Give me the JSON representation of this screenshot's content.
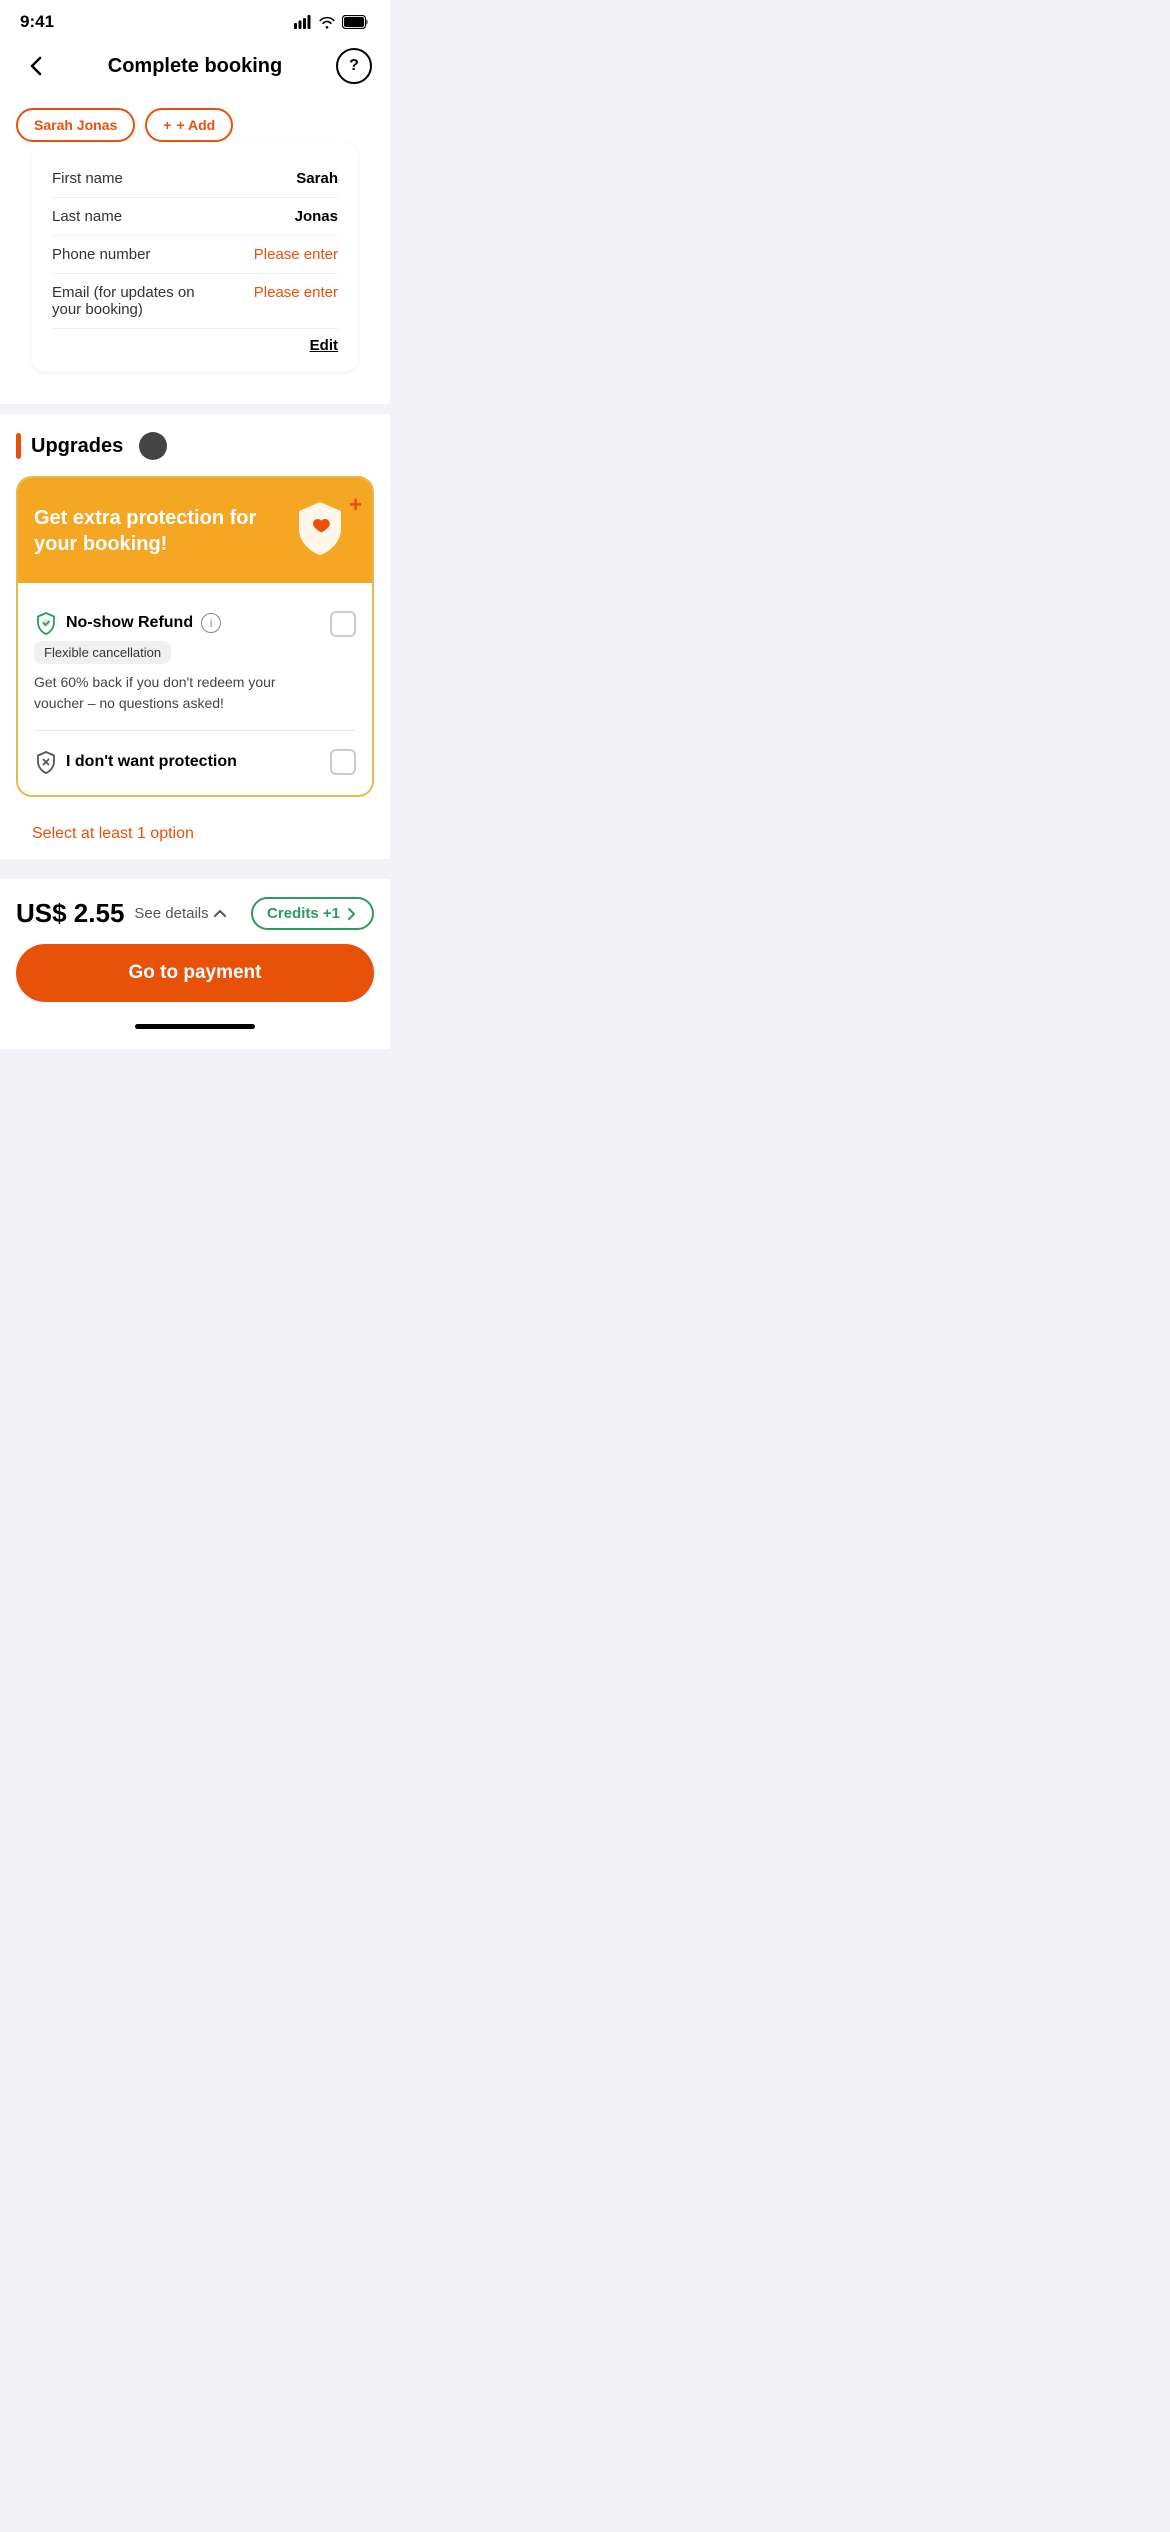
{
  "statusBar": {
    "time": "9:41",
    "signal": "●●●●",
    "wifi": "wifi",
    "battery": "battery"
  },
  "nav": {
    "title": "Complete booking",
    "backLabel": "‹",
    "helpLabel": "?"
  },
  "travelerChips": {
    "name": "Sarah Jonas",
    "addLabel": "+ Add"
  },
  "infoCard": {
    "rows": [
      {
        "label": "First name",
        "value": "Sarah",
        "isPlaceholder": false
      },
      {
        "label": "Last name",
        "value": "Jonas",
        "isPlaceholder": false
      },
      {
        "label": "Phone number",
        "value": "Please enter",
        "isPlaceholder": true
      },
      {
        "label": "Email (for updates on your booking)",
        "value": "Please enter",
        "isPlaceholder": true
      }
    ],
    "editLabel": "Edit"
  },
  "upgrades": {
    "sectionTitle": "Upgrades",
    "cardTitle": "Get extra protection for your booking!",
    "options": [
      {
        "icon": "shield-check-icon",
        "title": "No-show Refund",
        "badge": "Flexible cancellation",
        "description": "Get 60% back if you don't redeem your voucher – no questions asked!",
        "checked": false
      }
    ],
    "noProtection": {
      "title": "I don't want protection",
      "checked": false
    },
    "validationMsg": "Select at least 1 option"
  },
  "footer": {
    "price": "US$ 2.55",
    "seeDetails": "See details",
    "creditsLabel": "Credits +1",
    "goToPayment": "Go to payment"
  }
}
